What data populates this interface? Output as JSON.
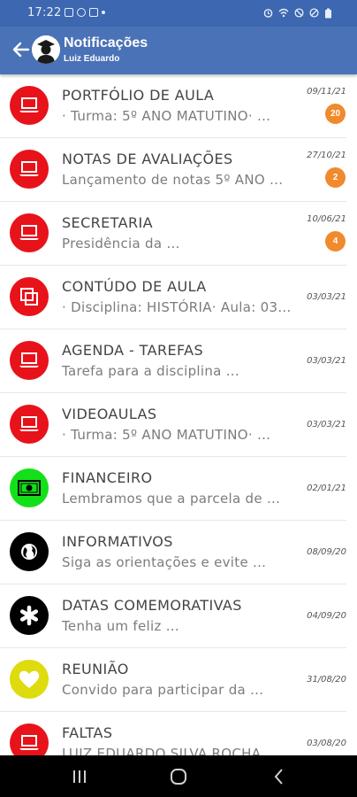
{
  "status_bar": {
    "time": "17:22"
  },
  "app_bar": {
    "title": "Notificações",
    "subtitle": "Luiz Eduardo"
  },
  "notifications": [
    {
      "title": "PORTFÓLIO DE AULA",
      "subtitle": "· Turma: 5º ANO MATUTINO· ...",
      "date": "09/11/21",
      "badge": "20",
      "icon": "laptop-icon",
      "color": "#e8121a"
    },
    {
      "title": "NOTAS DE AVALIAÇÕES",
      "subtitle": "Lançamento de notas 5º ANO ...",
      "date": "27/10/21",
      "badge": "2",
      "icon": "laptop-icon",
      "color": "#e8121a"
    },
    {
      "title": "SECRETARIA",
      "subtitle": "Presidência da ...",
      "date": "10/06/21",
      "badge": "4",
      "icon": "laptop-icon",
      "color": "#e8121a"
    },
    {
      "title": "CONTÚDO DE AULA",
      "subtitle": "· Disciplina: HISTÓRIA· Aula: 03...",
      "date": "03/03/21",
      "badge": "",
      "icon": "copy-icon",
      "color": "#e8121a"
    },
    {
      "title": "AGENDA - TAREFAS",
      "subtitle": "Tarefa para a disciplina ...",
      "date": "03/03/21",
      "badge": "",
      "icon": "laptop-icon",
      "color": "#e8121a"
    },
    {
      "title": "VIDEOAULAS",
      "subtitle": "· Turma: 5º ANO MATUTINO· ...",
      "date": "03/03/21",
      "badge": "",
      "icon": "laptop-icon",
      "color": "#e8121a"
    },
    {
      "title": "FINANCEIRO",
      "subtitle": "Lembramos que a parcela de ...",
      "date": "02/01/21",
      "badge": "",
      "icon": "money-icon",
      "color": "#14e01a"
    },
    {
      "title": "INFORMATIVOS",
      "subtitle": "Siga as orientações e evite ...",
      "date": "08/09/20",
      "badge": "",
      "icon": "globe-icon",
      "color": "#000000"
    },
    {
      "title": "DATAS COMEMORATIVAS",
      "subtitle": "Tenha um feliz ...",
      "date": "04/09/20",
      "badge": "",
      "icon": "asterisk-icon",
      "color": "#000000"
    },
    {
      "title": "REUNIÃO",
      "subtitle": "Convido para participar da ...",
      "date": "31/08/20",
      "badge": "",
      "icon": "heart-icon",
      "color": "#dedb0e"
    },
    {
      "title": "FALTAS",
      "subtitle": "LUIZ EDUARDO SILVA ROCHA ...",
      "date": "03/08/20",
      "badge": "",
      "icon": "laptop-icon",
      "color": "#e8121a"
    }
  ]
}
